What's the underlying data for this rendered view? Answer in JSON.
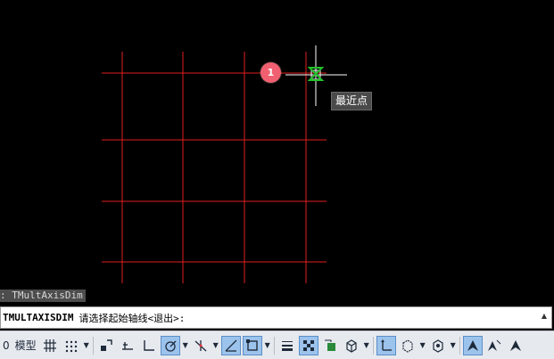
{
  "drawing": {
    "grid_color": "#e01e1e",
    "crosshair_color": "#ffffff",
    "snap_marker_color": "#22c02a",
    "badge_number": "1",
    "tooltip": "最近点"
  },
  "command_history": ": TMultAxisDim",
  "command_line": {
    "command": "TMULTAXISDIM",
    "prompt": "请选择起始轴线<退出>:"
  },
  "statusbar": {
    "left_number": "0",
    "model_label": "模型",
    "buttons": [
      {
        "icon": "grid-icon",
        "active": false
      },
      {
        "icon": "snap-dots-icon",
        "active": false,
        "dropdown": true
      },
      {
        "icon": "infer-constraints-icon",
        "active": false
      },
      {
        "icon": "dynamic-input-icon",
        "active": false
      },
      {
        "icon": "ortho-icon",
        "active": false
      },
      {
        "icon": "polar-tracking-icon",
        "active": true,
        "dropdown": true
      },
      {
        "icon": "isodraft-icon",
        "active": false,
        "dropdown": true
      },
      {
        "icon": "object-snap-tracking-icon",
        "active": true
      },
      {
        "icon": "object-snap-icon",
        "active": true,
        "dropdown": true
      },
      {
        "icon": "lineweight-icon",
        "active": false
      },
      {
        "icon": "transparency-icon",
        "active": true
      },
      {
        "icon": "selection-cycling-icon",
        "active": false
      },
      {
        "icon": "3d-object-snap-icon",
        "active": false,
        "dropdown": true
      },
      {
        "icon": "dynamic-ucs-icon",
        "active": true
      },
      {
        "icon": "selection-filter-icon",
        "active": false,
        "dropdown": true
      },
      {
        "icon": "gizmo-icon",
        "active": false,
        "dropdown": true
      },
      {
        "icon": "annotation-visibility-icon",
        "active": true
      },
      {
        "icon": "auto-scale-icon",
        "active": false
      },
      {
        "icon": "annotation-scale-icon",
        "active": false
      }
    ]
  }
}
